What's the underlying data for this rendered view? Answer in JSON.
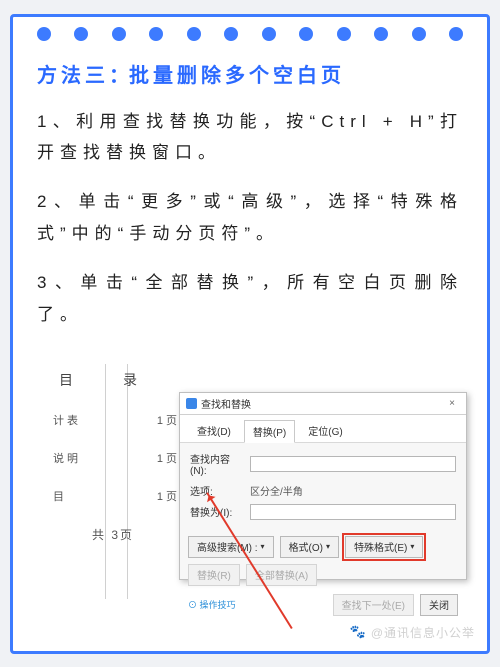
{
  "article": {
    "title_prefix": "方法三",
    "title_colon": "：",
    "title_rest": "批量删除多个空白页",
    "steps": [
      "1、利用查找替换功能，按“Ctrl + H”打开查找替换窗口。",
      "2、单击“更多”或“高级”，选择“特殊格式”中的“手动分页符”。",
      "3、单击“全部替换”，所有空白页删除了。"
    ]
  },
  "doc_panel": {
    "heading": "目　录",
    "rows": [
      {
        "label": "计表",
        "page": "1 页"
      },
      {
        "label": "说明",
        "page": "1 页"
      },
      {
        "label": "目",
        "page": "1 页"
      }
    ],
    "total": "共 3页"
  },
  "dialog": {
    "title": "查找和替换",
    "tabs": {
      "find": "查找(D)",
      "replace": "替换(P)",
      "goto": "定位(G)"
    },
    "find_label": "查找内容(N):",
    "options_label": "选项:",
    "options_value": "区分全/半角",
    "replace_label": "替换为(I):",
    "buttons": {
      "more": "高级搜索(M) :",
      "format": "格式(O)",
      "special": "特殊格式(E)",
      "replace": "替换(R)",
      "replace_all": "全部替换(A)",
      "find_next": "查找下一处(E)",
      "close": "关闭"
    },
    "tips_label": "⊙ 操作技巧"
  },
  "watermark": {
    "icon": "🐾",
    "text": "@通讯信息小公举"
  }
}
